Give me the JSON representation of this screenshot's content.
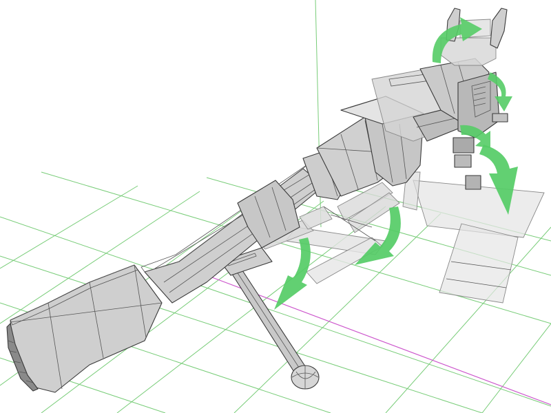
{
  "viewport": {
    "background": "#ffffff",
    "grid_color": "#77cc77",
    "axis_color": "#cc55cc",
    "model_fill": "#d2d2d2",
    "model_shadow": "#a9a9a9",
    "model_highlight": "#ececec",
    "ghost_fill": "#e6e6e6",
    "arrow_color": "#55cc66"
  },
  "icons": [
    "rotate-arrow-icon"
  ]
}
